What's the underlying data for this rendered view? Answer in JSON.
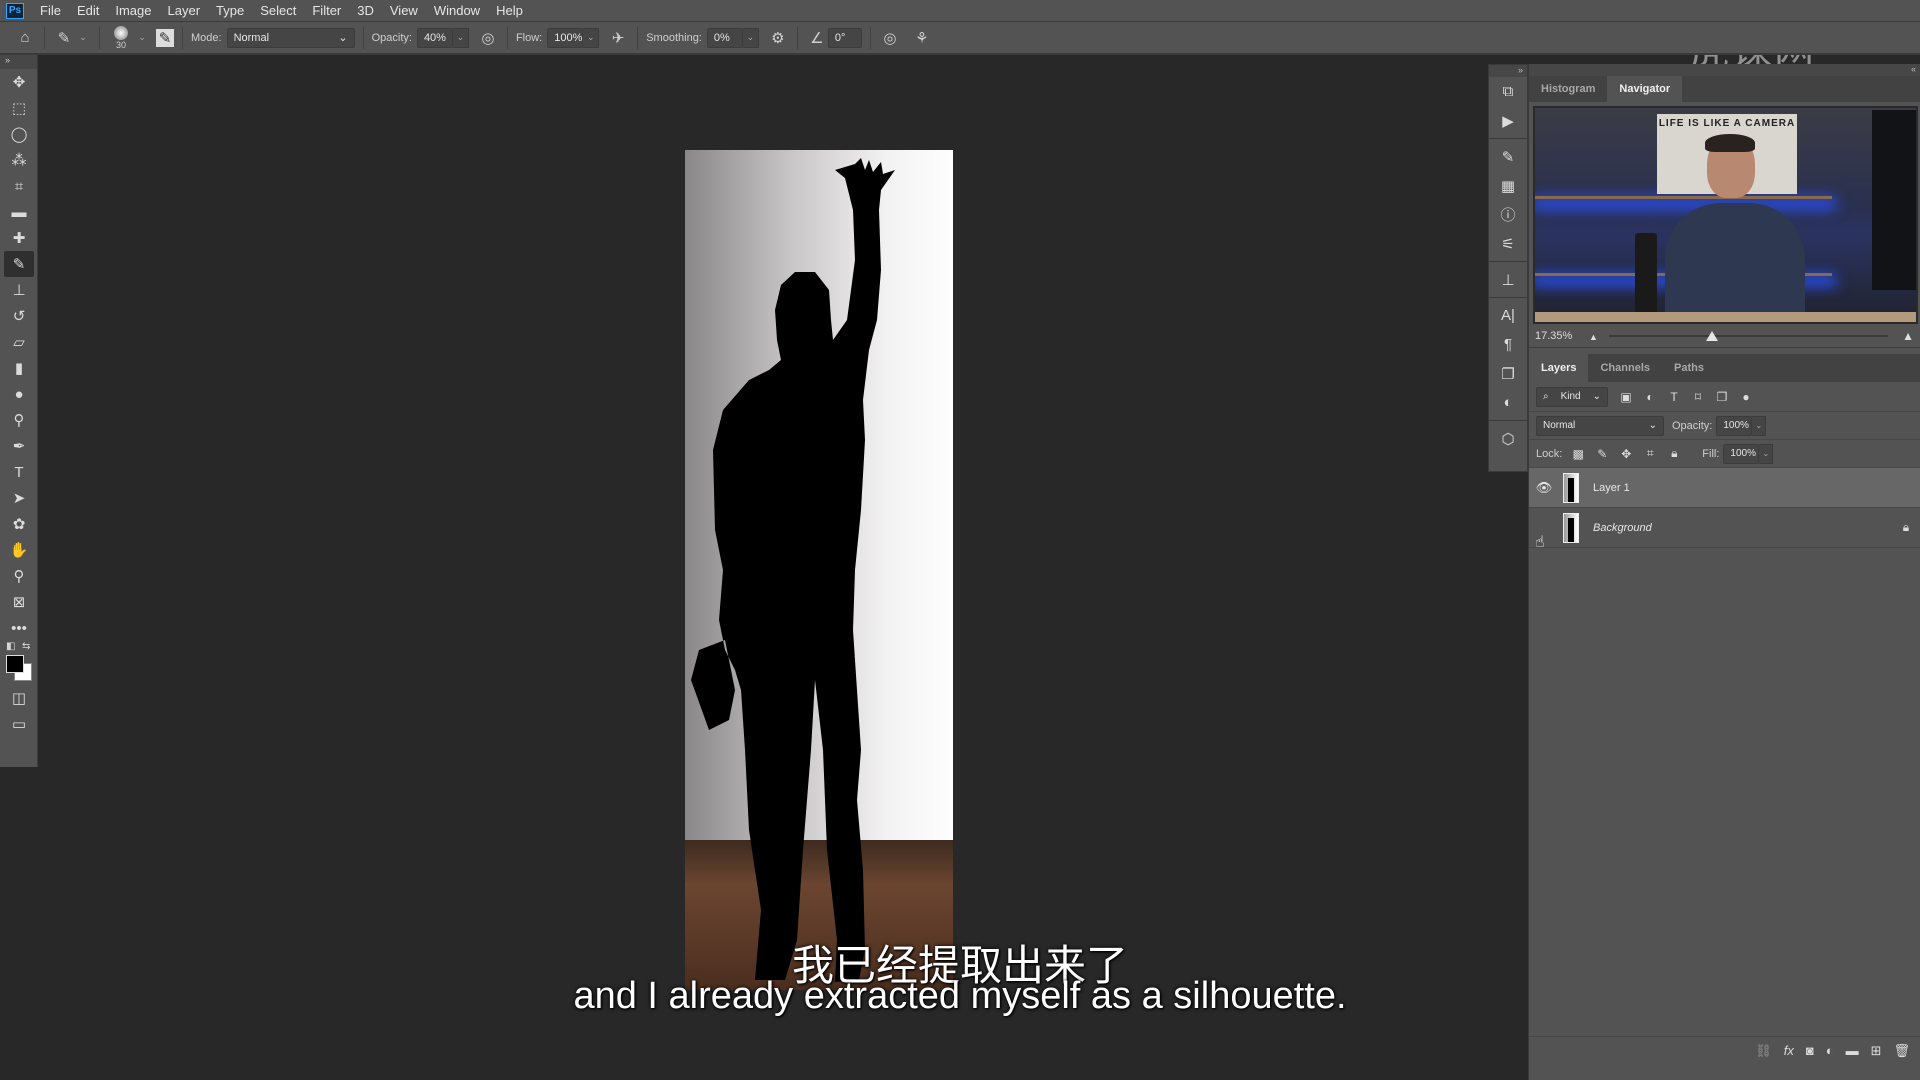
{
  "app": {
    "logo": "Ps"
  },
  "menu": [
    "File",
    "Edit",
    "Image",
    "Layer",
    "Type",
    "Select",
    "Filter",
    "3D",
    "View",
    "Window",
    "Help"
  ],
  "options_bar": {
    "brush_size": "30",
    "mode_label": "Mode:",
    "mode_value": "Normal",
    "opacity_label": "Opacity:",
    "opacity_value": "40%",
    "flow_label": "Flow:",
    "flow_value": "100%",
    "smoothing_label": "Smoothing:",
    "smoothing_value": "0%",
    "angle_value": "0°",
    "icons": [
      "home-icon",
      "brush-icon",
      "brush-preset-icon",
      "toggle-brush-panel-icon",
      "pressure-opacity-icon",
      "airbrush-icon",
      "smoothing-settings-gear-icon",
      "angle-icon",
      "pressure-size-icon",
      "symmetry-butterfly-icon"
    ]
  },
  "toolbox": {
    "tools": [
      "move",
      "marquee",
      "lasso",
      "quick-selection",
      "crop",
      "ruler",
      "healing-brush",
      "brush",
      "clone-stamp",
      "history-brush",
      "eraser",
      "gradient",
      "blur",
      "dodge",
      "pen",
      "type",
      "path-selection",
      "shape",
      "hand",
      "zoom",
      "frame",
      "more-tools"
    ],
    "active_tool": "brush",
    "foreground_color": "#000000",
    "background_color": "#ffffff"
  },
  "top_right": {
    "icons": [
      "search-icon",
      "workspace-icon",
      "share-icon"
    ],
    "watermark": "虎课网"
  },
  "navigator": {
    "tabs": [
      {
        "label": "Histogram",
        "active": false
      },
      {
        "label": "Navigator",
        "active": true
      }
    ],
    "thumbnail_poster_text": "LIFE IS LIKE A CAMERA",
    "zoom_value": "17.35%",
    "zoom_slider_fraction": 0.37
  },
  "dock_icons": [
    "history-icon",
    "play-actions-icon",
    "brush-settings-icon",
    "libraries-icon",
    "info-icon",
    "adjustments-icon",
    "clone-source-icon",
    "character-icon",
    "paragraph-icon",
    "glyphs-icon",
    "styles-icon",
    "3d-icon"
  ],
  "layers_panel": {
    "tabs": [
      {
        "label": "Layers",
        "active": true
      },
      {
        "label": "Channels",
        "active": false
      },
      {
        "label": "Paths",
        "active": false
      }
    ],
    "filter_label": "Kind",
    "blend_mode": "Normal",
    "opacity_label": "Opacity:",
    "opacity_value": "100%",
    "lock_label": "Lock:",
    "fill_label": "Fill:",
    "fill_value": "100%",
    "layers": [
      {
        "name": "Layer 1",
        "visible": true,
        "selected": true,
        "locked": false
      },
      {
        "name": "Background",
        "visible": false,
        "selected": false,
        "locked": true
      }
    ],
    "footer_icons": [
      "link-icon",
      "fx-icon",
      "mask-icon",
      "adjustment-layer-icon",
      "group-folder-icon",
      "new-layer-icon",
      "trash-icon"
    ]
  },
  "subtitles": {
    "chinese": "我已经提取出来了",
    "english": "and I already extracted myself as a silhouette."
  }
}
